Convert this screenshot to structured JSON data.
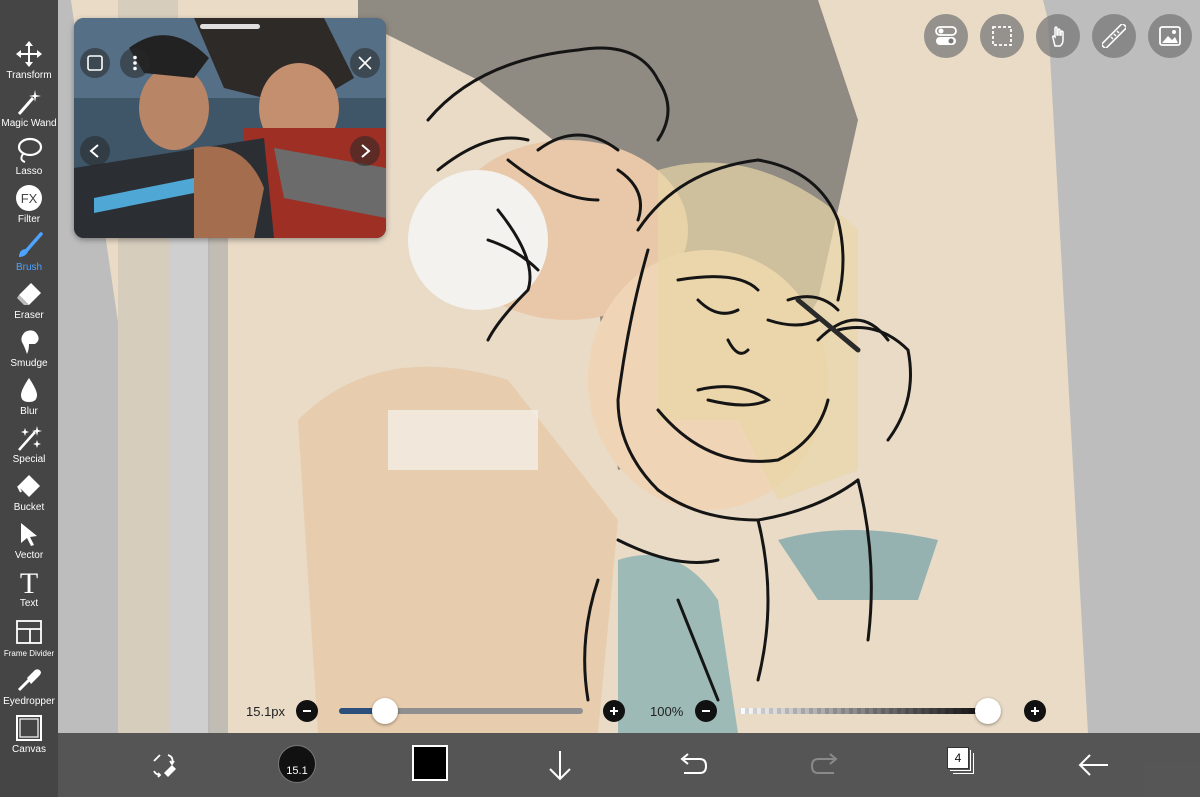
{
  "toolbar": {
    "tools": [
      {
        "label": "Transform",
        "icon": "transform-icon"
      },
      {
        "label": "Magic Wand",
        "icon": "magic-wand-icon"
      },
      {
        "label": "Lasso",
        "icon": "lasso-icon"
      },
      {
        "label": "Filter",
        "icon": "filter-fx-icon",
        "icon_text": "FX"
      },
      {
        "label": "Brush",
        "icon": "brush-icon",
        "active": true
      },
      {
        "label": "Eraser",
        "icon": "eraser-icon"
      },
      {
        "label": "Smudge",
        "icon": "smudge-icon"
      },
      {
        "label": "Blur",
        "icon": "blur-drop-icon"
      },
      {
        "label": "Special",
        "icon": "sparkle-icon"
      },
      {
        "label": "Bucket",
        "icon": "bucket-icon"
      },
      {
        "label": "Vector",
        "icon": "cursor-arrow-icon"
      },
      {
        "label": "Text",
        "icon": "text-t-icon",
        "icon_text": "T"
      },
      {
        "label": "Frame Divider",
        "icon": "frame-divider-icon"
      },
      {
        "label": "Eyedropper",
        "icon": "eyedropper-icon"
      },
      {
        "label": "Canvas",
        "icon": "canvas-icon"
      }
    ],
    "active_color": "#4da3ff"
  },
  "quick_buttons": [
    "toggle-icon",
    "selection-icon",
    "touch-hand-icon",
    "ruler-icon",
    "image-icon"
  ],
  "reference_window": {
    "controls": [
      "expand-icon",
      "more-icon",
      "close-icon",
      "prev-arrow-icon",
      "next-arrow-icon"
    ]
  },
  "brush_size": {
    "value_text": "15.1px",
    "fraction": 0.19
  },
  "opacity": {
    "value_text": "100%",
    "fraction": 1.0
  },
  "bottom_bar": {
    "brush_preview_text": "15.1",
    "current_color": "#000000",
    "layer_count": "4",
    "icons": [
      "swap-colors-icon",
      "brush-preview",
      "color-swatch",
      "download-arrow-icon",
      "undo-icon",
      "redo-icon",
      "layers-icon",
      "back-arrow-icon"
    ]
  }
}
